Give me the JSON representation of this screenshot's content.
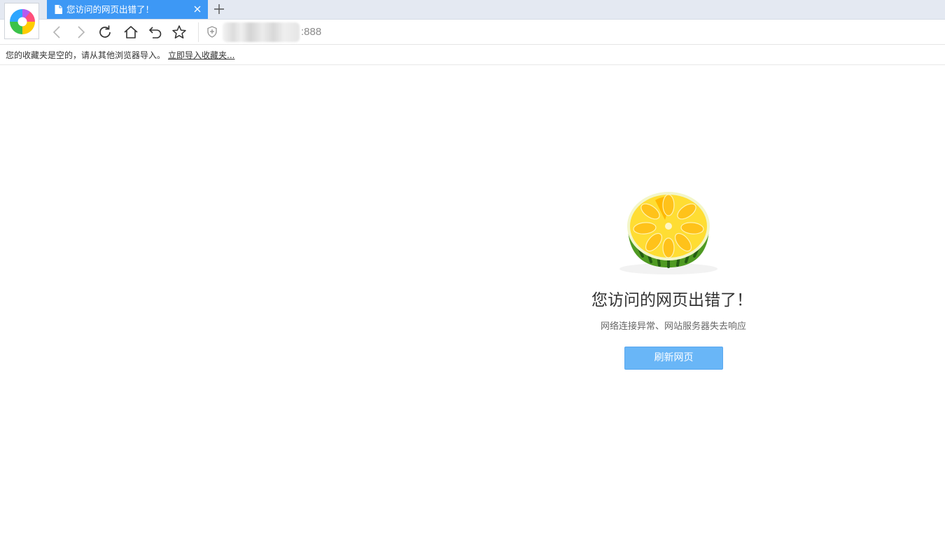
{
  "browser": {
    "logo_icon": "browser-logo-icon",
    "tab": {
      "title": "您访问的网页出错了！",
      "icon": "document-icon",
      "close_icon": "close-icon"
    },
    "new_tab_icon": "plus-icon",
    "toolbar": {
      "buttons": [
        "back-icon",
        "forward-icon",
        "refresh-icon",
        "home-icon",
        "undo-icon",
        "star-icon"
      ],
      "address": {
        "security_icon": "shield-icon",
        "url_suffix": ":888"
      }
    },
    "bookmark_bar": {
      "message": "您的收藏夹是空的，请从其他浏览器导入。",
      "import_link": "立即导入收藏夹..."
    }
  },
  "error_page": {
    "illustration": "watermelon-icon",
    "title": "您访问的网页出错了！",
    "subtitle": "网络连接异常、网站服务器失去响应",
    "refresh_button": "刷新网页"
  },
  "colors": {
    "tab_active": "#3d98f5",
    "refresh_button": "#69b6f7",
    "tabstrip_bg": "#e4e9f2"
  }
}
